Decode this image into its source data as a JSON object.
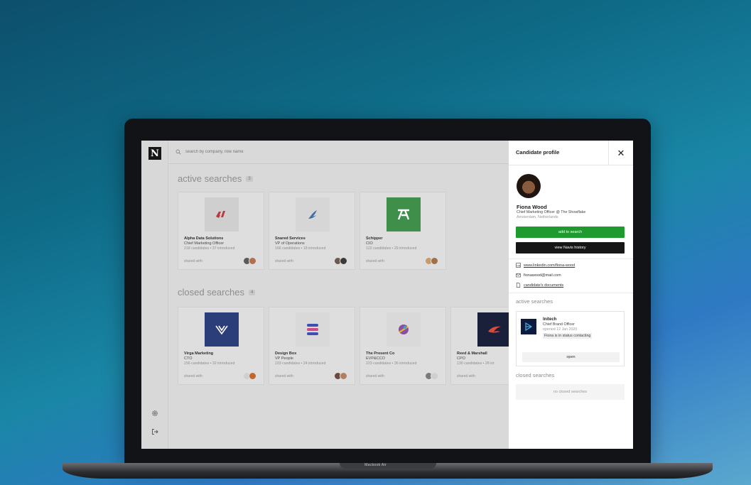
{
  "app": {
    "logo_letter": "N",
    "search": {
      "placeholder": "search by company, role name"
    },
    "sidebar": {
      "items": [
        {
          "icon": "gear-icon"
        },
        {
          "icon": "logout-icon"
        }
      ]
    }
  },
  "active_searches": {
    "title": "active searches",
    "count": "3",
    "cards": [
      {
        "company": "Alpha Data Solutions",
        "role": "Chief Marketing Officer",
        "stats": "218 candidates • 37 introduced",
        "shared_label": "shared with:",
        "logo_bg": "#cfcfcf",
        "logo_color": "#b83a3a"
      },
      {
        "company": "Snared Services",
        "role": "VP of Operations",
        "stats": "166 candidates • 18 introduced",
        "shared_label": "shared with:",
        "logo_bg": "#d6d6d6",
        "logo_color": "#3d6fa5"
      },
      {
        "company": "Schipper",
        "role": "CIO",
        "stats": "122 candidates • 29 introduced",
        "shared_label": "shared with:",
        "logo_bg": "#3f8f4a",
        "logo_color": "#ffffff"
      }
    ]
  },
  "closed_searches": {
    "title": "closed searches",
    "count": "4",
    "cards": [
      {
        "company": "Virga Marketing",
        "role": "CTO",
        "stats": "156 candidates • 32 introduced",
        "shared_label": "shared with:",
        "logo_bg": "#2b3e7a",
        "logo_color": "#ffffff"
      },
      {
        "company": "Design Box",
        "role": "VP People",
        "stats": "103 candidates • 24 introduced",
        "shared_label": "shared with:",
        "logo_bg": "#d9d9d9",
        "logo_color": "#3d4fb0"
      },
      {
        "company": "The Present Co",
        "role": "EVP&CCO",
        "stats": "223 candidates • 36 introduced",
        "shared_label": "shared with:",
        "logo_bg": "#d9d9d9",
        "logo_color": "#8a4fa5"
      },
      {
        "company": "Reed & Marshall",
        "role": "CPO",
        "stats": "130 candidates • 28 int",
        "shared_label": "shared with:",
        "logo_bg": "#1a1f3a",
        "logo_color": "#d84a3a"
      }
    ]
  },
  "panel": {
    "title": "Candidate profile",
    "close_icon": "close-icon",
    "name": "Fiona Wood",
    "job": "Chief Marketing Officer @ The Showflake",
    "location": "Amsterdam, Netherlands",
    "add_button": "add to search",
    "history_button": "view Navis history",
    "linkedin": "www.linkedin.com/fiona-wood",
    "email": "fionawood@mail.com",
    "documents": "candidate's documents",
    "active_title": "active searches",
    "active_card": {
      "company": "Initech",
      "role": "Chief Brand Officer",
      "opened": "opened 12 Jan 2020",
      "status": "Fiona is in status contacting",
      "open_button": "open"
    },
    "closed_title": "closed searches",
    "no_closed": "no closed searches"
  },
  "device": {
    "label": "Macbook Air"
  },
  "colors": {
    "accent_green": "#1f9a2e",
    "dark_button": "#161616"
  }
}
